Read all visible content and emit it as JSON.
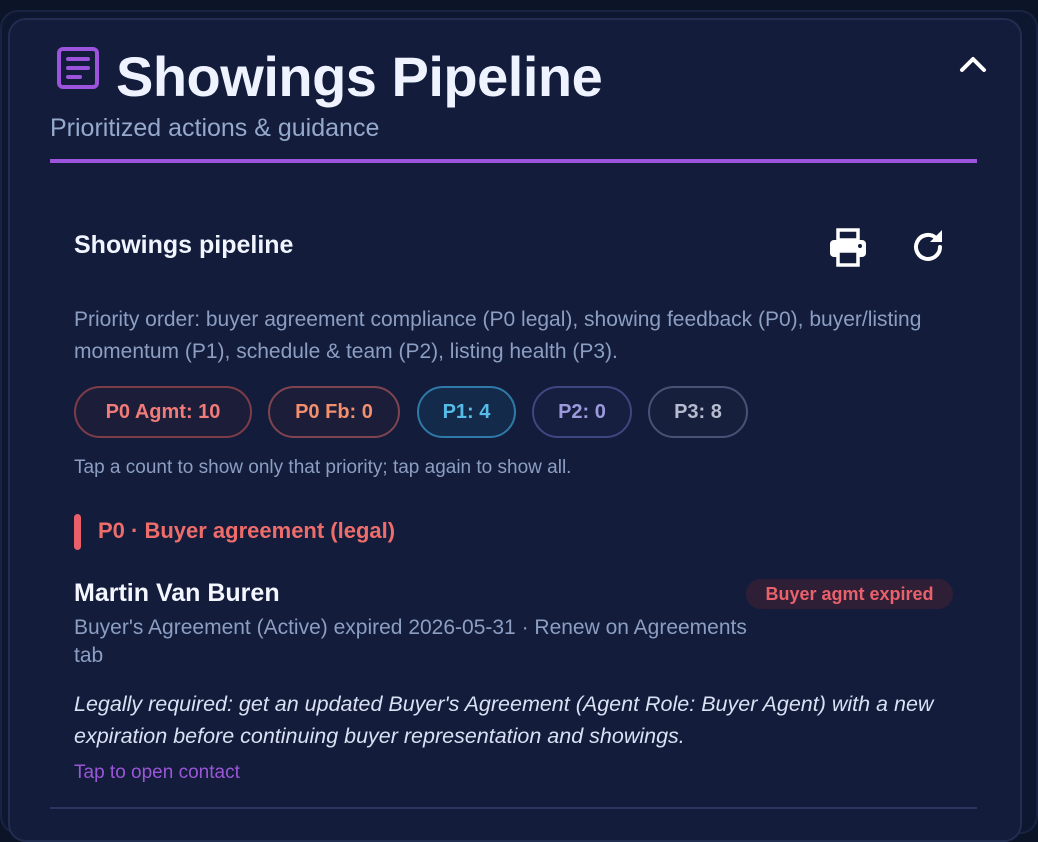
{
  "header": {
    "icon": "document-list-icon",
    "title": "Showings Pipeline",
    "subtitle": "Prioritized actions & guidance",
    "collapse_icon": "chevron-up-icon",
    "accent_color": "#9d54dc"
  },
  "section": {
    "title": "Showings pipeline",
    "print_icon": "printer-icon",
    "refresh_icon": "refresh-icon",
    "priority_order": "Priority order: buyer agreement compliance (P0 legal), showing feedback (P0), buyer/listing momentum (P1), schedule & team (P2), listing health (P3).",
    "chips": [
      {
        "label": "P0 Agmt: 10",
        "color": "#f07b78"
      },
      {
        "label": "P0 Fb: 0",
        "color": "#f38f6d"
      },
      {
        "label": "P1: 4",
        "color": "#56bde8"
      },
      {
        "label": "P2: 0",
        "color": "#9c99dc"
      },
      {
        "label": "P3: 8",
        "color": "#b6bcd0"
      }
    ],
    "hint": "Tap a count to show only that priority; tap again to show all."
  },
  "group": {
    "title": "P0 · Buyer agreement (legal)",
    "color": "#e9606a"
  },
  "item": {
    "name": "Martin Van Buren",
    "badge": "Buyer agmt expired",
    "detail": "Buyer's Agreement (Active) expired 2026-05-31 · Renew on Agreements tab",
    "guidance": "Legally required: get an updated Buyer's Agreement (Agent Role: Buyer Agent) with a new expiration before continuing buyer representation and showings.",
    "link": "Tap to open contact"
  }
}
